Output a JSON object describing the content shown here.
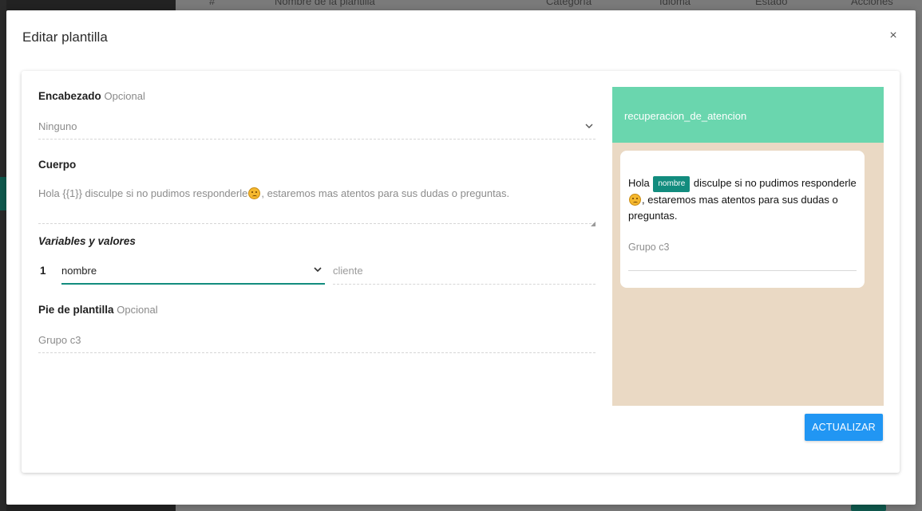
{
  "background": {
    "table_headers": [
      "#",
      "Nombre de la plantilla",
      "Categoría",
      "Idioma",
      "Estado",
      "Acciones"
    ]
  },
  "modal": {
    "title": "Editar plantilla",
    "close_glyph": "×"
  },
  "form": {
    "header": {
      "label": "Encabezado",
      "optional": "Opcional",
      "value": "Ninguno"
    },
    "body": {
      "label": "Cuerpo",
      "text_before_emoji": "Hola {{1}} disculpe si no pudimos responderle",
      "text_after_emoji": ", estaremos mas atentos para sus dudas o preguntas."
    },
    "variables": {
      "label": "Variables y valores",
      "items": [
        {
          "index": "1",
          "variable": "nombre",
          "value_placeholder": "cliente"
        }
      ]
    },
    "footer": {
      "label": "Pie de plantilla",
      "optional": "Opcional",
      "value": "Grupo c3"
    }
  },
  "preview": {
    "template_name": "recuperacion_de_atencion",
    "message_prefix": "Hola",
    "variable_chip": "nombre",
    "message_mid": "disculpe si no pudimos responderle",
    "message_end": ", estaremos mas atentos para sus dudas o preguntas.",
    "footer": "Grupo c3",
    "header_color": "#6ad6ae",
    "chat_background": "#ead9c4",
    "chip_color": "#128c7e"
  },
  "actions": {
    "update_label": "ACTUALIZAR",
    "update_color": "#2196f3"
  }
}
